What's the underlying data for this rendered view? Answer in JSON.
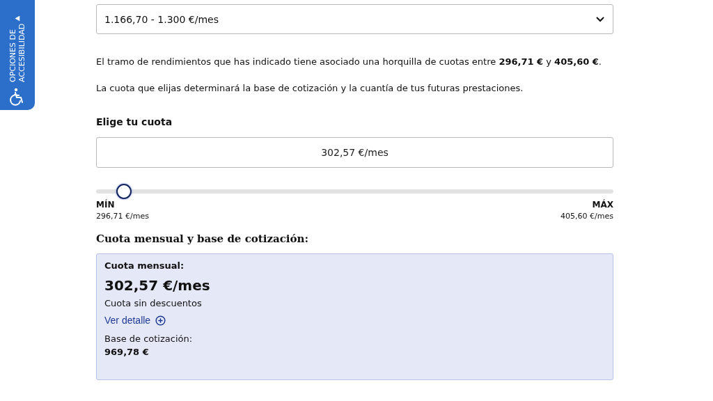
{
  "accessibility_tab": {
    "label_lines": [
      "OPCIONES DE",
      "ACCESIBILIDAD"
    ]
  },
  "income_range": {
    "value": "1.166,70 - 1.300 €/mes"
  },
  "paragraphs": [
    "El tramo de rendimientos que has indicado tiene asociado una horquilla de cuotas entre **296,71 €** y **405,60 €**.",
    "La cuota que elijas determinará la base de cotización y la cuantía de tus futuras prestaciones."
  ],
  "quota_label": "Elige tu cuota",
  "quota_field": {
    "value": "302,57 €/mes"
  },
  "slider": {
    "level": 0.054,
    "min_label": "MÍN",
    "min_value": "296,71 €/mes",
    "max_label": "MÁX",
    "max_value": "405,60 €/mes"
  },
  "summary_heading": "Cuota mensual y base de cotización:",
  "summary": {
    "quota_label": "Cuota mensual:",
    "quota_value": "302,57 €/mes",
    "quota_note": "Cuota sin descuentos",
    "detail_link": "Ver detalle",
    "base_label": "Base de cotización:",
    "base_value": "969,78 €"
  }
}
